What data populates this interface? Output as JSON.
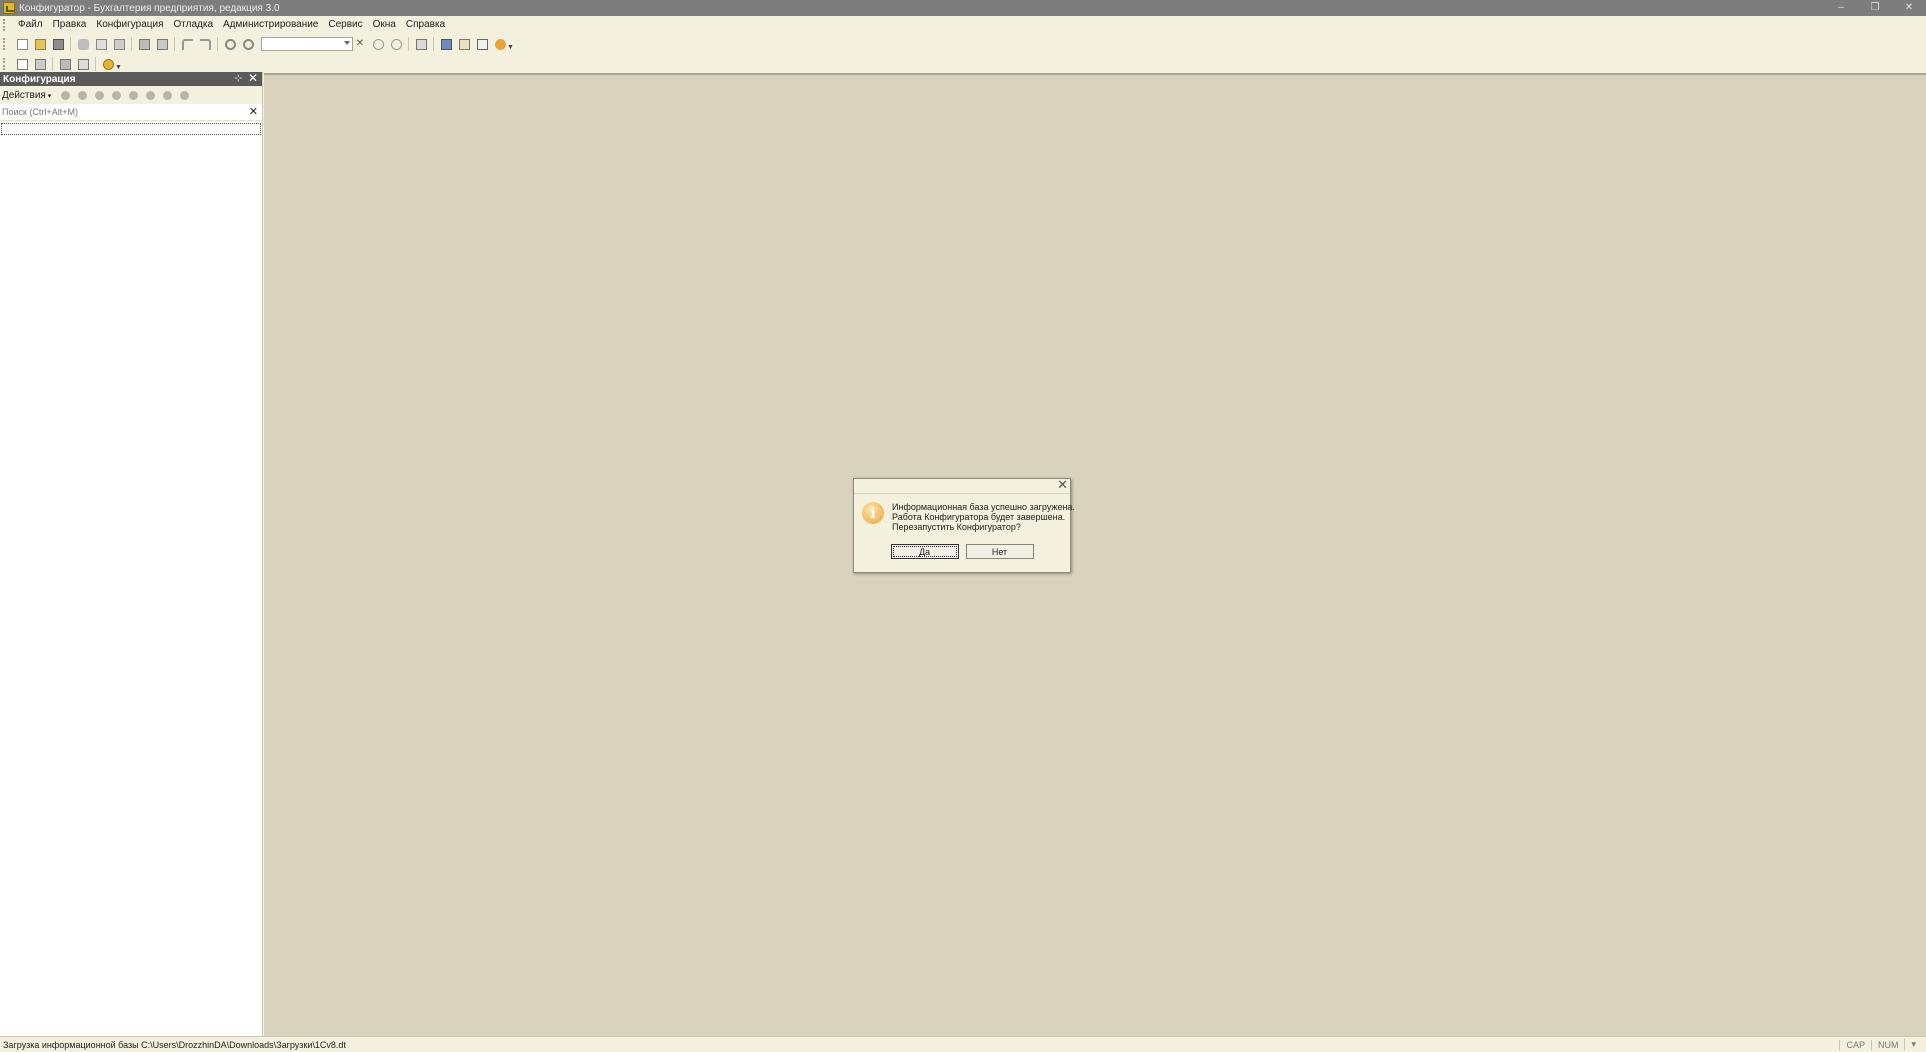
{
  "window": {
    "title": "Конфигуратор - Бухгалтерия предприятия, редакция 3.0",
    "minimize": "–",
    "restore": "❐",
    "close": "✕"
  },
  "menu": {
    "items": [
      "Файл",
      "Правка",
      "Конфигурация",
      "Отладка",
      "Администрирование",
      "Сервис",
      "Окна",
      "Справка"
    ]
  },
  "config_panel": {
    "title": "Конфигурация",
    "pin": "⊹",
    "close": "✕",
    "actions_label": "Действия",
    "search_placeholder": "Поиск (Ctrl+Alt+M)",
    "search_clear": "✕"
  },
  "dialog": {
    "close": "✕",
    "icon_glyph": "i",
    "lines": [
      "Информационная база успешно загружена.",
      "Работа Конфигуратора будет завершена.",
      "Перезапустить Конфигуратор?"
    ],
    "yes_label": "Да",
    "no_label": "Нет"
  },
  "status_bar": {
    "message": "Загрузка информационной базы C:\\Users\\DrozzhinDA\\Downloads\\Загрузки\\1Cv8.dt",
    "cap": "CAP",
    "num": "NUM",
    "extra": "▾"
  }
}
